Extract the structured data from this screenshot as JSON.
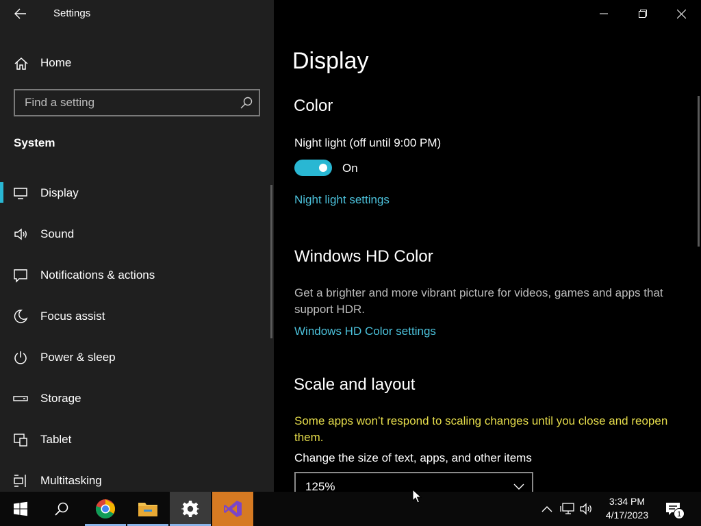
{
  "window": {
    "title": "Settings",
    "controls": [
      "minimize",
      "restore",
      "close"
    ]
  },
  "sidebar": {
    "home_label": "Home",
    "search": {
      "placeholder": "Find a setting",
      "value": ""
    },
    "section_title": "System",
    "items": [
      {
        "label": "Display",
        "icon": "monitor-icon",
        "selected": true
      },
      {
        "label": "Sound",
        "icon": "speaker-icon"
      },
      {
        "label": "Notifications & actions",
        "icon": "message-icon"
      },
      {
        "label": "Focus assist",
        "icon": "moon-icon"
      },
      {
        "label": "Power & sleep",
        "icon": "power-icon"
      },
      {
        "label": "Storage",
        "icon": "drive-icon"
      },
      {
        "label": "Tablet",
        "icon": "tablet-icon"
      },
      {
        "label": "Multitasking",
        "icon": "multitask-icon"
      }
    ]
  },
  "main": {
    "page_title": "Display",
    "color": {
      "heading": "Color",
      "night_light_label": "Night light (off until 9:00 PM)",
      "night_light_state": "On",
      "night_light_on": true,
      "night_light_link": "Night light settings"
    },
    "hd_color": {
      "heading": "Windows HD Color",
      "description": "Get a brighter and more vibrant picture for videos, games and apps that support HDR.",
      "link": "Windows HD Color settings"
    },
    "scale": {
      "heading": "Scale and layout",
      "warning": "Some apps won’t respond to scaling changes until you close and reopen them.",
      "size_label": "Change the size of text, apps, and other items",
      "size_value": "125%"
    }
  },
  "taskbar": {
    "apps": [
      {
        "name": "start-button",
        "icon": "windows-logo-icon"
      },
      {
        "name": "search-button",
        "icon": "search-icon"
      },
      {
        "name": "chrome",
        "icon": "chrome-icon",
        "running": true
      },
      {
        "name": "file-explorer",
        "icon": "folder-icon",
        "running": true
      },
      {
        "name": "settings",
        "icon": "gear-icon",
        "running": true,
        "active": true
      },
      {
        "name": "visual-studio",
        "icon": "visual-studio-icon",
        "running": true
      }
    ],
    "clock": {
      "time": "3:34 PM",
      "date": "4/17/2023"
    },
    "notification_count": "1"
  },
  "colors": {
    "accent": "#29b7d3",
    "link": "#4cc2dc",
    "warning": "#e5dc4b",
    "sidebar_bg": "#1f1f1f",
    "content_bg": "#000000"
  }
}
